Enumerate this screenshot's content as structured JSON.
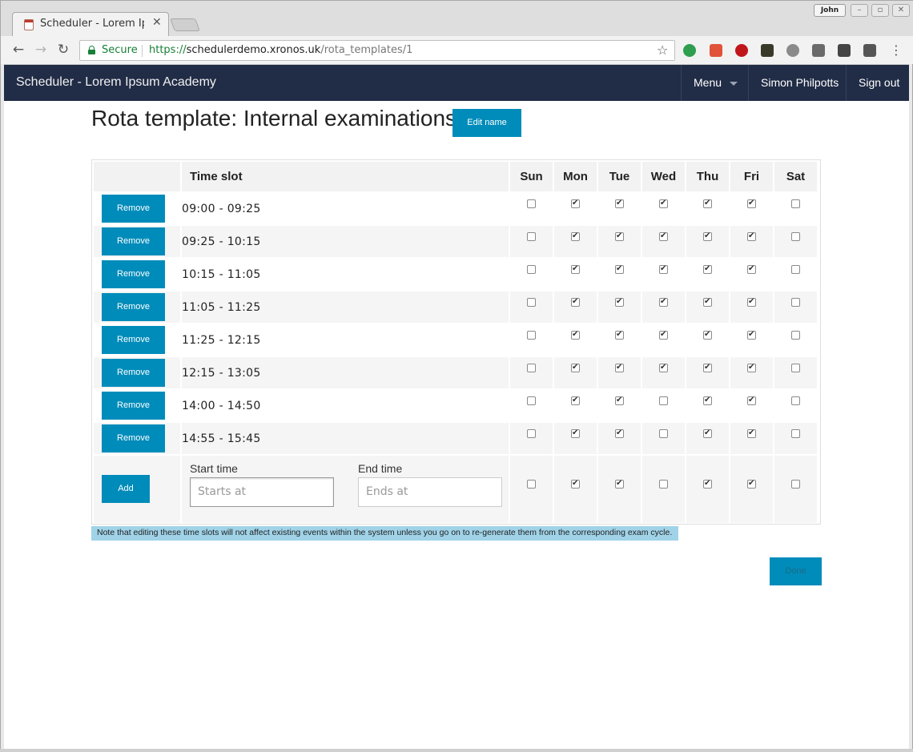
{
  "browser": {
    "tab_title": "Scheduler - Lorem Ipsum Academy",
    "user_chip": "John",
    "secure_label": "Secure",
    "url_scheme": "https://",
    "url_host": "schedulerdemo.xronos.uk",
    "url_path": "/rota_templates/1"
  },
  "navbar": {
    "brand": "Scheduler - Lorem Ipsum Academy",
    "menu_label": "Menu",
    "user_label": "Simon Philpotts",
    "signout_label": "Sign out"
  },
  "page": {
    "title": "Rota template: Internal examinations",
    "edit_name_label": "Edit name"
  },
  "table": {
    "slot_header": "Time slot",
    "days": [
      "Sun",
      "Mon",
      "Tue",
      "Wed",
      "Thu",
      "Fri",
      "Sat"
    ],
    "remove_label": "Remove",
    "rows": [
      {
        "slot": "09:00 - 09:25",
        "checks": [
          false,
          true,
          true,
          true,
          true,
          true,
          false
        ]
      },
      {
        "slot": "09:25 - 10:15",
        "checks": [
          false,
          true,
          true,
          true,
          true,
          true,
          false
        ]
      },
      {
        "slot": "10:15 - 11:05",
        "checks": [
          false,
          true,
          true,
          true,
          true,
          true,
          false
        ]
      },
      {
        "slot": "11:05 - 11:25",
        "checks": [
          false,
          true,
          true,
          true,
          true,
          true,
          false
        ]
      },
      {
        "slot": "11:25 - 12:15",
        "checks": [
          false,
          true,
          true,
          true,
          true,
          true,
          false
        ]
      },
      {
        "slot": "12:15 - 13:05",
        "checks": [
          false,
          true,
          true,
          true,
          true,
          true,
          false
        ]
      },
      {
        "slot": "14:00 - 14:50",
        "checks": [
          false,
          true,
          true,
          false,
          true,
          true,
          false
        ]
      },
      {
        "slot": "14:55 - 15:45",
        "checks": [
          false,
          true,
          true,
          false,
          true,
          true,
          false
        ]
      }
    ],
    "add_row": {
      "add_label": "Add",
      "start_label": "Start time",
      "start_placeholder": "Starts at",
      "end_label": "End time",
      "end_placeholder": "Ends at",
      "checks": [
        false,
        true,
        true,
        false,
        true,
        true,
        false
      ]
    }
  },
  "note": "Note that editing these time slots will not affect existing events within the system unless you go on to re-generate them from the corresponding exam cycle.",
  "done_label": "Done",
  "colors": {
    "navbar_bg": "#212c46",
    "button_bg": "#008cba",
    "note_bg": "#a0d3e8"
  }
}
